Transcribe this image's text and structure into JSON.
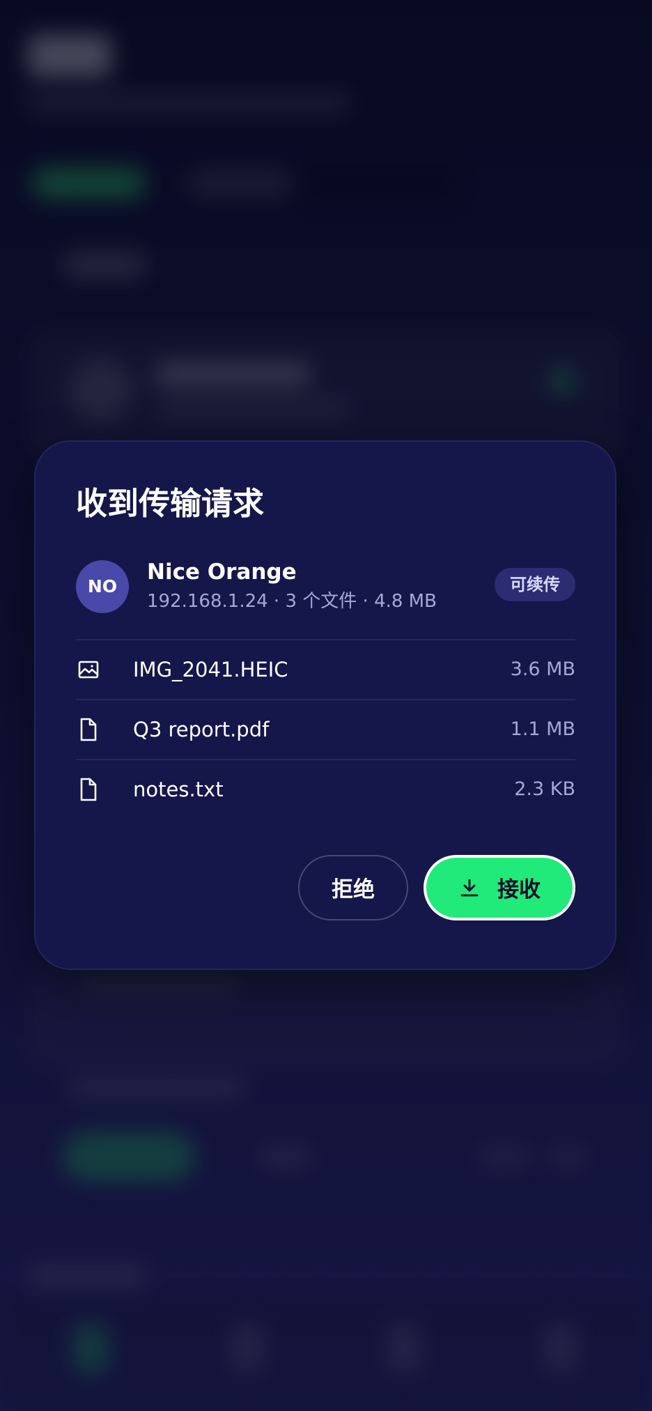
{
  "dialog": {
    "title": "收到传输请求",
    "sender": {
      "initials": "NO",
      "name": "Nice Orange",
      "meta": "192.168.1.24 · 3 个文件 · 4.8 MB",
      "badge": "可续传"
    },
    "files": [
      {
        "name": "IMG_2041.HEIC",
        "size": "3.6 MB",
        "icon": "image-icon"
      },
      {
        "name": "Q3 report.pdf",
        "size": "1.1 MB",
        "icon": "file-icon"
      },
      {
        "name": "notes.txt",
        "size": "2.3 KB",
        "icon": "file-icon"
      }
    ],
    "actions": {
      "decline_label": "拒绝",
      "accept_label": "接收"
    }
  },
  "colors": {
    "accent": "#22ea7a",
    "dialog_bg": "#15164a",
    "avatar_bg": "#4849a8",
    "badge_bg": "#2b2c72",
    "muted_text": "#a6a8d8"
  }
}
